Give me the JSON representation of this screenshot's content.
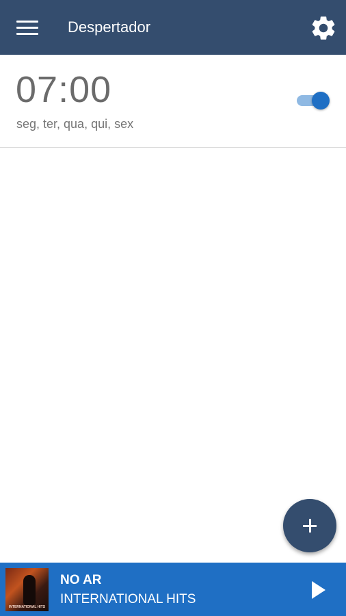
{
  "header": {
    "title": "Despertador",
    "menu_icon": "hamburger-menu-icon",
    "settings_icon": "gear-icon",
    "background_color": "#344d6e"
  },
  "alarms": [
    {
      "time": "07:00",
      "days": "seg, ter, qua, qui, sex",
      "enabled": true
    }
  ],
  "fab": {
    "icon": "plus-icon",
    "color": "#344d6e"
  },
  "player": {
    "status": "NO AR",
    "station": "INTERNATIONAL HITS",
    "cover_text": "INTERNATIONAL HITS",
    "play_icon": "play-icon",
    "background_color": "#1f6fc4"
  },
  "colors": {
    "toggle_on": "#1f6fc4",
    "toggle_track": "#8fb9e3"
  }
}
